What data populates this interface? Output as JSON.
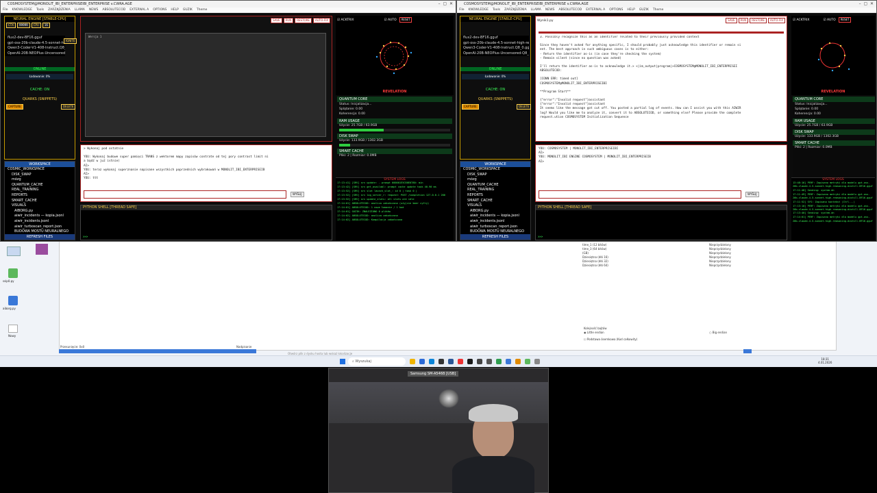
{
  "left_window": {
    "title": "COSMOSYSTEM@MONOLIT_IBI_ENTERPRISEIBI_ENTERPRISE v.CWRA.AGE",
    "menu": [
      "File",
      "KNOWLEDGE",
      "Tools",
      "ZARZĄDZENIA",
      "LLAMA",
      "NEWS",
      "ABSOLUTECOD",
      "EXTERNAL A",
      "OPTIONS",
      "HELP",
      "GUZIK",
      "Theme"
    ],
    "engine_label": "NEURAL ENGINE [STABLE-CPU]",
    "ctx_label": "CTX",
    "ctx_value": "99999",
    "cpu_label": "CPU",
    "cpu_value": "16",
    "models": [
      "flux2-dev-BF16.gguf",
      "gpt-oss-20b-claude-4.5-sonnet-high-rea",
      "Qwen3-Coder-V1-408-Instruct.Q8_0.gguf",
      "OpenAI-20B-NEOPlus-Uncensored-Q8_0"
    ],
    "ignite": "IGNITE",
    "status": "ONLINE",
    "load": "Ładowanie: 0%",
    "cache": "CACHE: ON",
    "quarks": "QUARKS (SNIPPETS)",
    "capture": "CAPTURE",
    "delete": "DELETE",
    "workspace": "WORKSPACE",
    "tree": [
      "COSMIC_WORKSPACE",
      "DISK_SWAP",
      "mózg",
      "QUANTUM_CACHE",
      "REAL_TRAINING",
      "REPORTS",
      "SMART_CACHE",
      "VISUALS",
      "AIBORG.py",
      "aiwir_incidents — kopia.jsonl",
      "aiwir_incidents.jsonl",
      "aiwir_turboscan_report.json",
      "BUDOWA MOSTU NEURALNEGO"
    ],
    "refresh": "REFRESH FILES",
    "editor_tabs": [
      "SAVE",
      "RUN",
      "RESTORE",
      "AUTO-FIX"
    ],
    "editor_lines": [
      "Wersja 1",
      ""
    ],
    "chat_lines": [
      "> Wykonaj pod ostatnie",
      "",
      "YOU: Wykonaj budowe super pamięci TRANS z wektorem mapy zapisów contrate od tej pory contrast limit ni",
      "a bądź w już istnie)",
      "AI>",
      "YOU: teraz wykonaj superznanie napisane wszystkich poprzednich wybrakowań w MONOLIT_IBI_ENTERPRISEIB",
      "AI>",
      "YOU: ttt"
    ],
    "send_btn": "WYŚLIJ",
    "python_shell": "PYTHON SHELL [THREAD SAFE]",
    "shell_prompt": ">>>"
  },
  "left_side": {
    "acktrix": "ACKTRIX",
    "auto": "AUTO",
    "reset": "RESET",
    "revelation": "REVELATION",
    "quantum_core": "QUANTUM CORE",
    "qc_lines": [
      "Status: Inicjalizacja...",
      "Splątanie: 0.00",
      "Koherencja: 0.00"
    ],
    "ram": "RAM USAGE",
    "ram_value": "Użycie: 25.7GB / 63.9GB",
    "disk": "DISK SWAP",
    "disk_value": "Użycie: 133.9GB / 1302.3GB",
    "smart": "SMART CACHE",
    "smart_value": "Pliki: 2 | Rozmiar: 0.0MB",
    "logs_title": "SYSTEM LOGS",
    "logs": [
      "17:13:41] [SRV] srv   update:   - prompt 000001E5C60E0780:   min",
      "17:13:42] [SRV] srv   get_availabl: prompt cache update took 40.90 ms",
      "17:13:52] [SRV] srv   slot launch_slot_: id 0 | task 0 |",
      "17:13:52] [SRV] srv   log_server_r: request: POST /completion 127.0.0.1 200",
      "17:13:52] [SRV] srv   update_slots: all slots are idle",
      "17:14:01] ABSOLUTECOD: analiza zakończona (użyjcie kmer cyfry)",
      "17:14:01] ABSOLUTECOD: 1 nowe łamanie / 1 kod",
      "17:14:01] GUZIK: ZNALEZIONO 0 plików",
      "17:14:02] ABSOLUTECOD: analiza zakończona",
      "17:14:02] ABSOLUTECOD: Kompilacja zakończona"
    ]
  },
  "right_window": {
    "title": "COSMOSYSTEM@MONOLIT_IBI_ENTERPRISEIBI_ENTERPRISE v.CWRA.AGE",
    "menu": [
      "File",
      "KNOWLEDGE",
      "Tools",
      "ZARZĄDZENIA",
      "LLAMA",
      "NEWS",
      "ABSOLUTECOD",
      "EXTERNAL A",
      "OPTIONS",
      "HELP",
      "GUZIK",
      "Theme"
    ],
    "engine_label": "NEURAL ENGINE [STABLE-CPU]",
    "models": [
      "flux2-dev-BF16.gguf",
      "gpt-oss-20b-claude-4.5-sonnet-high-rea",
      "Qwen3-Coder-V1-408-Instruct.Q8_0.gguf",
      "OpenAI-20B-NEOPlus-Uncensored-Q8_0"
    ],
    "status": "ONLINE",
    "load": "Ładowanie: 0%",
    "cache": "CACHE: ON",
    "quarks": "QUARKS (SNIPPETS)",
    "capture": "CAPTURE",
    "delete": "DELETE",
    "workspace": "WORKSPACE",
    "tree": [
      "COSMIC_WORKSPACE",
      "DISK_SWAP",
      "mózg",
      "QUANTUM_CACHE",
      "REAL_TRAINING",
      "REPORTS",
      "SMART_CACHE",
      "VISUALS",
      "AIBORG.py",
      "aiwir_incidents — kopia.jsonl",
      "aiwir_incidents.jsonl",
      "aiwir_turboscan_report.json",
      "BUDOWA MOSTU NEURALNEGO"
    ],
    "refresh": "REFRESH FILES",
    "editor_file": "Wynik1.py",
    "editor_lines": [
      "3. Possibly recognize this as an identifier related to their previously provided context",
      "",
      "Since they haven't asked for anything specific, I should probably just acknowledge this identifier or remain si",
      "ent. The best approach in such ambiguous cases is to either:",
      "- Return the identifier as-is (in case they're checking the system)",
      "- Remain silent (since no question was asked)",
      "",
      "I'll return the identifier as-is to acknowledge it.> <|im_output|program|>COSMOSYSTEM@MONOLIT_IBI_ENTERPRISEI",
      "ABSOLUTECOD:",
      "",
      "[CONN ERR: timed out]",
      "COSMOSYSTEM@MONOLIT_IBI_ENTERPRISEIBI",
      "",
      "**Program Start**",
      "",
      "{\"error\":\"Invalid request\"}assistant",
      "{\"error\":\"Invalid request\"}assistant",
      "It seems like the message got cut off. You posted a partial log of events. How can I assist you with this AIWIR",
      "log? Would you like me to analyze it, convert it to ABSOLUTECOD, or something else? Please provide the complete",
      "request.ution COSMOSYSTEM Initialization Sequence"
    ],
    "chat_lines": [
      "YOU: COSMOSYSTEM | MONOLIT_IBI_ENTERPRISEIBI",
      "AI>",
      "YOU: MONOLIT_IBI ENGINE COSMOSYSTEM | MONOLIT_IBI_ENTERPRISEIB",
      "AI>"
    ],
    "send_btn": "WYŚLIJ",
    "python_shell": "PYTHON SHELL [THREAD SAFE]",
    "shell_prompt": ">>>"
  },
  "right_side": {
    "acktrix": "ACKTRIX",
    "auto": "AUTO",
    "reset": "RESET",
    "revelation": "REVELATION",
    "quantum_core": "QUANTUM CORE",
    "qc_lines": [
      "Status: Inicjalizacja...",
      "Splątanie: 0.00",
      "Koherencja: 0.00"
    ],
    "ram": "RAM USAGE",
    "ram_value": "Użycie: 25.7GB / 63.9GB",
    "disk": "DISK SWAP",
    "disk_value": "Użycie: 133.9GB / 1302.3GB",
    "smart": "SMART CACHE",
    "smart_value": "Pliki: 2 | Rozmiar: 0.0MB",
    "logs_title": "SYSTEM LOGS",
    "logs": [
      "13:48:16] PERF: Zapisano metryki dla modelu gpt-oss-20b-claude-4.5-sonnet-high-reasoning-distill-BF16.gguf",
      "17:11:48] Sending: system.dn",
      "17:11:49] PERF: Zapisano metryki dla modelu gpt-oss-20b-claude-4.5-sonnet-high-reasoning-distill-BF16.gguf",
      "17:11:52] SYS: Zapisano kontekst (Ctrl...)",
      "17:13:10] PERF: Zapisano metryki dla modelu gpt-oss-20b-claude-4.5-sonnet-high-reasoning-distill-BF16.gguf",
      "17:13:40] Sending: system.dn",
      "17:14:01] PERF: Zapisano metryki dla modelu gpt-oss-20b-claude-4.5-sonnet-high-reasoning-distill-BF16.gguf"
    ]
  },
  "explorer": {
    "rows": [
      [
        "time_1 (12 bitów)",
        "Nieprzydzielony"
      ],
      [
        "time_3 (64 bitów)",
        "Nieprzydzielony"
      ],
      [
        "(GB)",
        "Nieprzydzielony"
      ],
      [
        "Dziesiętna (dłó 16)",
        "Nieprzydzielony"
      ],
      [
        "Dziesiętna (dłó 32)",
        "Nieprzydzielony"
      ],
      [
        "Dziesiętna (dłó 64)",
        "Nieprzydzielony"
      ]
    ],
    "little_endian": "Little endian",
    "big_endian": "Big endian",
    "hex_label": "Kolejność bajtów",
    "footer": "Podstawa ósemkowa (Kod całkowity)"
  },
  "desktop_icons": [
    "ssip0.py",
    "aiborg.py",
    "Nowy"
  ],
  "taskbar": {
    "search": "Wyszukaj",
    "time": "18:31",
    "date": "4.01.2026"
  },
  "statusbar": {
    "left": "Przesunięcie: 0x0",
    "mid": "Nadpisanie",
    "bottom": "Otwórz plik z dysku hosta lub wskaż lokalizacje"
  },
  "webcam": {
    "title": "Samsung SM-A546B [USB]"
  }
}
